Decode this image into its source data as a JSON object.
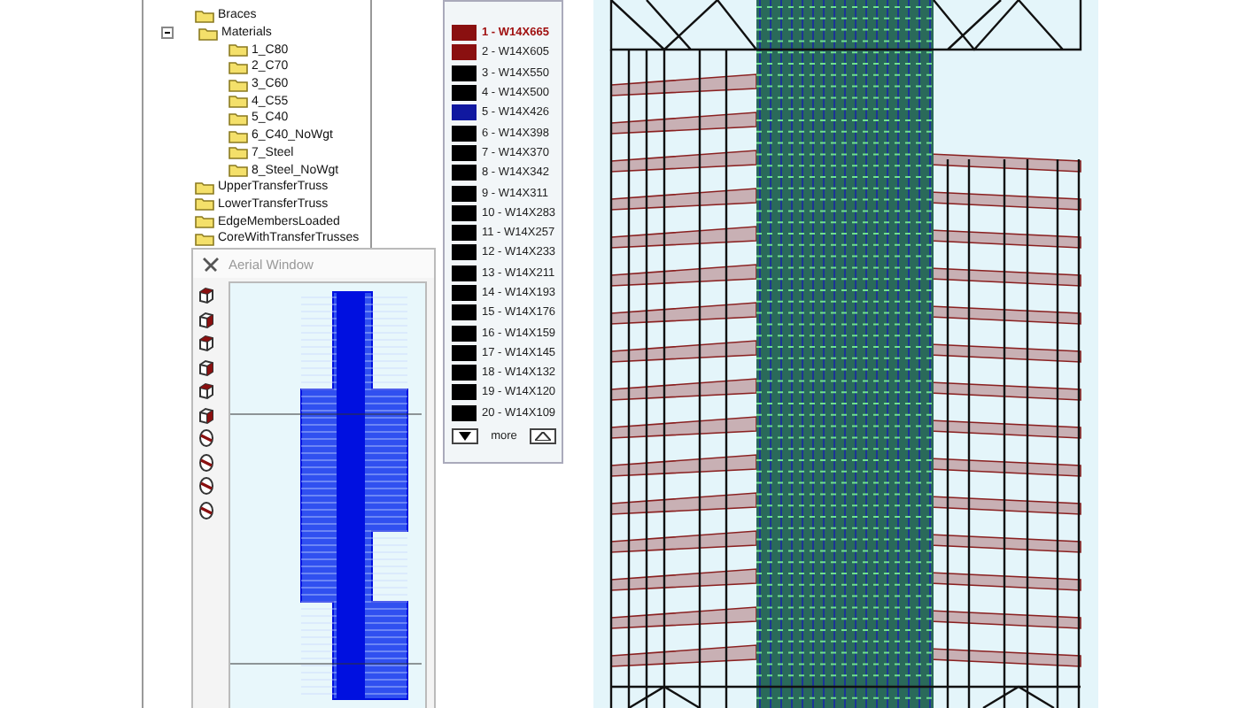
{
  "tree": {
    "items": [
      {
        "label": "Braces"
      },
      {
        "label": "Materials",
        "expanded": true,
        "children": [
          {
            "label": "1_C80"
          },
          {
            "label": "2_C70"
          },
          {
            "label": "3_C60"
          },
          {
            "label": "4_C55"
          },
          {
            "label": "5_C40"
          },
          {
            "label": "6_C40_NoWgt"
          },
          {
            "label": "7_Steel"
          },
          {
            "label": "8_Steel_NoWgt"
          }
        ]
      },
      {
        "label": "UpperTransferTruss"
      },
      {
        "label": "LowerTransferTruss"
      },
      {
        "label": "EdgeMembersLoaded"
      },
      {
        "label": "CoreWithTransferTrusses"
      }
    ]
  },
  "legend": {
    "items": [
      {
        "label": "1 - W14X665",
        "color": "#8a1010",
        "selected": true
      },
      {
        "label": "2 - W14X605",
        "color": "#8a1010",
        "selected": false
      },
      {
        "label": "3 - W14X550",
        "color": "#000000",
        "selected": false
      },
      {
        "label": "4 - W14X500",
        "color": "#000000",
        "selected": false
      },
      {
        "label": "5 - W14X426",
        "color": "#1018a0",
        "selected": false
      },
      {
        "label": "6 - W14X398",
        "color": "#000000",
        "selected": false
      },
      {
        "label": "7 - W14X370",
        "color": "#000000",
        "selected": false
      },
      {
        "label": "8 - W14X342",
        "color": "#000000",
        "selected": false
      },
      {
        "label": "9 - W14X311",
        "color": "#000000",
        "selected": false
      },
      {
        "label": "10 - W14X283",
        "color": "#000000",
        "selected": false
      },
      {
        "label": "11 - W14X257",
        "color": "#000000",
        "selected": false
      },
      {
        "label": "12 - W14X233",
        "color": "#000000",
        "selected": false
      },
      {
        "label": "13 - W14X211",
        "color": "#000000",
        "selected": false
      },
      {
        "label": "14 - W14X193",
        "color": "#000000",
        "selected": false
      },
      {
        "label": "15 - W14X176",
        "color": "#000000",
        "selected": false
      },
      {
        "label": "16 - W14X159",
        "color": "#000000",
        "selected": false
      },
      {
        "label": "17 - W14X145",
        "color": "#000000",
        "selected": false
      },
      {
        "label": "18 - W14X132",
        "color": "#000000",
        "selected": false
      },
      {
        "label": "19 - W14X120",
        "color": "#000000",
        "selected": false
      },
      {
        "label": "20 - W14X109",
        "color": "#000000",
        "selected": false
      }
    ],
    "more_label": "more"
  },
  "aerial_window": {
    "title": "Aerial Window"
  }
}
